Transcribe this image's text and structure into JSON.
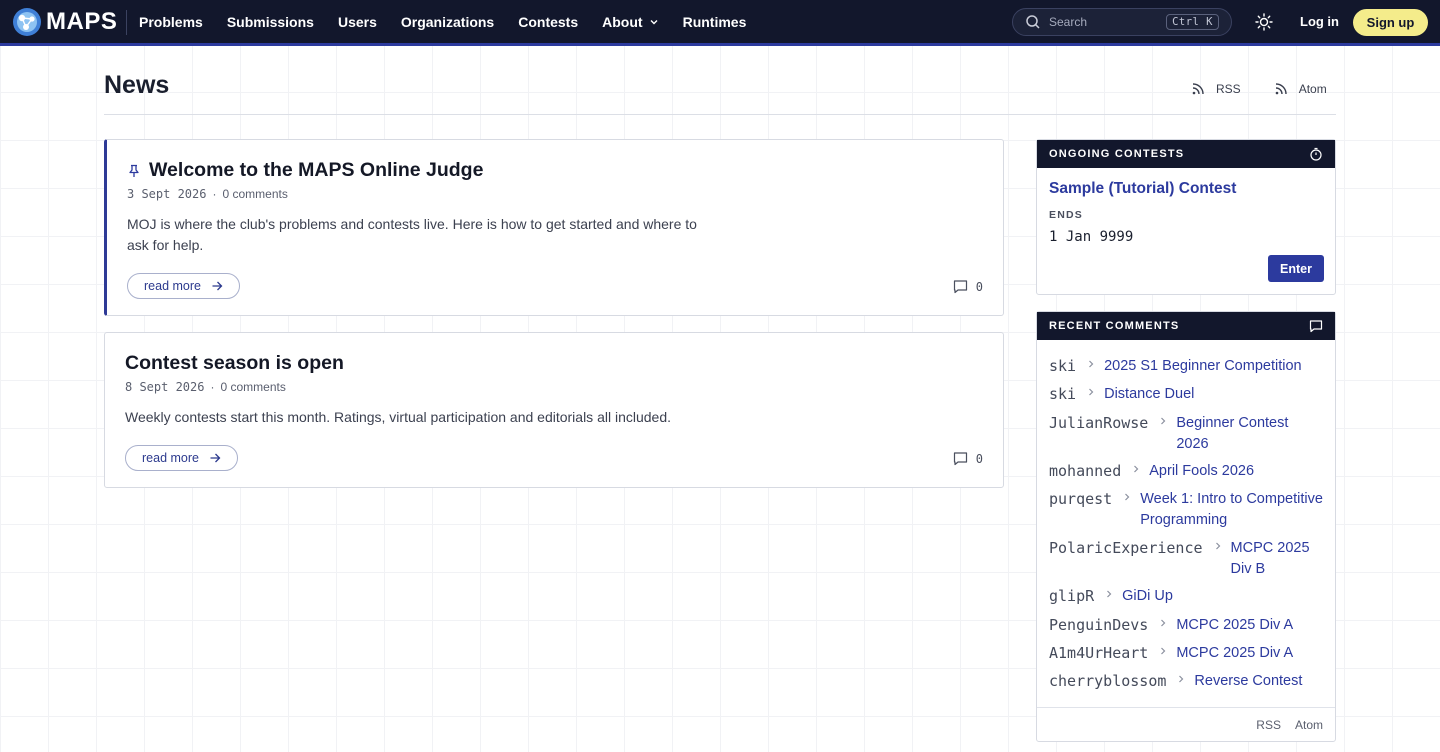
{
  "navbar": {
    "brand": "MAPS",
    "links": [
      "Problems",
      "Submissions",
      "Users",
      "Organizations",
      "Contests",
      "About",
      "Runtimes"
    ],
    "search_placeholder": "Search",
    "search_shortcut": "Ctrl K",
    "login": "Log in",
    "signup": "Sign up",
    "icons": [
      "maps-logo-icon",
      "chevron-down-icon",
      "search-icon",
      "sun-icon"
    ],
    "colors": {
      "bar": "#12172c",
      "accent": "#2c3a9e",
      "signup": "#f4ec8b"
    }
  },
  "page": {
    "title": "News",
    "feeds": [
      "RSS",
      "Atom"
    ]
  },
  "news": [
    {
      "title": "Welcome to the MAPS Online Judge",
      "pinned": true,
      "date": "3 Sept 2026",
      "comments_text": "0 comments",
      "summary": "MOJ is where the club's problems and contests live. Here is how to get started and where to ask for help.",
      "read_more": "read more",
      "comment_count": "0"
    },
    {
      "title": "Contest season is open",
      "pinned": false,
      "date": "8 Sept 2026",
      "comments_text": "0 comments",
      "summary": "Weekly contests start this month. Ratings, virtual participation and editorials all included.",
      "read_more": "read more",
      "comment_count": "0"
    }
  ],
  "sidebar": {
    "ongoing": {
      "heading": "ONGOING CONTESTS",
      "contest_name": "Sample (Tutorial) Contest",
      "ends_label": "ENDS",
      "ends_value": "1 Jan 9999",
      "enter": "Enter"
    },
    "recent_comments": {
      "heading": "RECENT COMMENTS",
      "items": [
        {
          "user": "ski",
          "target": "2025 S1 Beginner Competition"
        },
        {
          "user": "ski",
          "target": "Distance Duel"
        },
        {
          "user": "JulianRowse",
          "target": "Beginner Contest 2026"
        },
        {
          "user": "mohanned",
          "target": "April Fools 2026"
        },
        {
          "user": "purqest",
          "target": "Week 1: Intro to Competitive Programming"
        },
        {
          "user": "PolaricExperience",
          "target": "MCPC 2025 Div B"
        },
        {
          "user": "glipR",
          "target": "GiDi Up"
        },
        {
          "user": "PenguinDevs",
          "target": "MCPC 2025 Div A"
        },
        {
          "user": "A1m4UrHeart",
          "target": "MCPC 2025 Div A"
        },
        {
          "user": "cherryblossom",
          "target": "Reverse Contest"
        }
      ],
      "footer": [
        "RSS",
        "Atom"
      ]
    }
  }
}
